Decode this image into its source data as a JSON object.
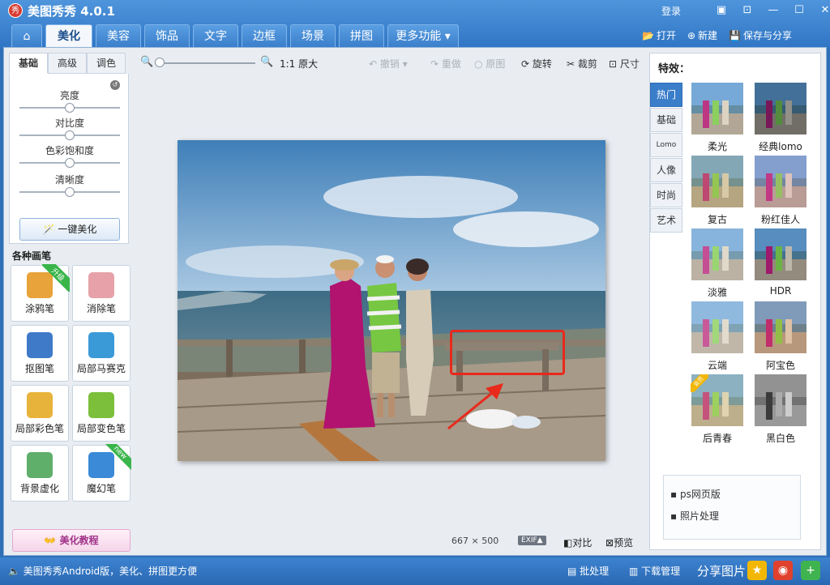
{
  "app": {
    "logo": "秀",
    "title": "美图秀秀 4.0.1",
    "login": "登录"
  },
  "window_buttons": [
    "▣",
    "⊡",
    "—",
    "☐",
    "✕"
  ],
  "tabs": [
    {
      "label": "⌂",
      "icon": "home-icon"
    },
    {
      "label": "美化",
      "active": true
    },
    {
      "label": "美容"
    },
    {
      "label": "饰品"
    },
    {
      "label": "文字"
    },
    {
      "label": "边框"
    },
    {
      "label": "场景"
    },
    {
      "label": "拼图"
    },
    {
      "label": "更多功能 ▾"
    }
  ],
  "top_actions": {
    "open": "打开",
    "new": "新建",
    "save": "保存与分享"
  },
  "left": {
    "subtabs": [
      "基础",
      "高级",
      "调色"
    ],
    "sliders": [
      {
        "label": "亮度",
        "value": 0.5
      },
      {
        "label": "对比度",
        "value": 0.5
      },
      {
        "label": "色彩饱和度",
        "value": 0.5
      },
      {
        "label": "清晰度",
        "value": 0.5
      }
    ],
    "auto_button": "一键美化",
    "pens_title": "各种画笔",
    "pens": [
      {
        "label": "涂鸦笔",
        "ribbon": "升级",
        "color": "#e8a33a"
      },
      {
        "label": "消除笔",
        "ribbon": "",
        "color": "#e6a2a8"
      },
      {
        "label": "抠图笔",
        "ribbon": "",
        "color": "#3f7ac9"
      },
      {
        "label": "局部马赛克",
        "ribbon": "",
        "color": "#3a9ad8"
      },
      {
        "label": "局部彩色笔",
        "ribbon": "",
        "color": "#e8b33a"
      },
      {
        "label": "局部变色笔",
        "ribbon": "",
        "color": "#7bbf3a"
      },
      {
        "label": "背景虚化",
        "ribbon": "",
        "color": "#5fae6a"
      },
      {
        "label": "魔幻笔",
        "ribbon": "new",
        "color": "#3a8ad8"
      }
    ],
    "tutorial": "美化教程"
  },
  "toolbar": {
    "actual": "1:1 原大",
    "undo": "撤销",
    "redo": "重做",
    "original": "原图",
    "rotate": "旋转",
    "crop": "裁剪",
    "size": "尺寸"
  },
  "canvas": {
    "dims": "667 × 500",
    "exif": "EXIF▲",
    "compare": "对比",
    "preview": "预览"
  },
  "effects": {
    "title": "特效：",
    "categories": [
      "热门",
      "基础",
      "Lomo",
      "人像",
      "时尚",
      "艺术"
    ],
    "items": [
      {
        "label": "柔光",
        "tint": "#ffffff",
        "alpha": 0.15
      },
      {
        "label": "经典lomo",
        "tint": "#102030",
        "alpha": 0.35
      },
      {
        "label": "复古",
        "tint": "#d9c27a",
        "alpha": 0.3
      },
      {
        "label": "粉红佳人",
        "tint": "#f3a8c8",
        "alpha": 0.25
      },
      {
        "label": "淡雅",
        "tint": "#ffffff",
        "alpha": 0.25
      },
      {
        "label": "HDR",
        "tint": "#304060",
        "alpha": 0.15
      },
      {
        "label": "云端",
        "tint": "#ffffff",
        "alpha": 0.3
      },
      {
        "label": "阿宝色",
        "tint": "#ff9a60",
        "alpha": 0.2
      },
      {
        "label": "后青春",
        "tint": "#f4e3a0",
        "alpha": 0.3,
        "badge": "会员"
      },
      {
        "label": "黑白色",
        "tint": "#808080",
        "alpha": 0.0,
        "gray": true
      }
    ],
    "ad_links": [
      "ps网页版",
      "照片处理"
    ]
  },
  "bottom": {
    "promo": "美图秀秀Android版，美化、拼图更方便",
    "batch": "批处理",
    "download": "下载管理",
    "share": "分享图片"
  }
}
